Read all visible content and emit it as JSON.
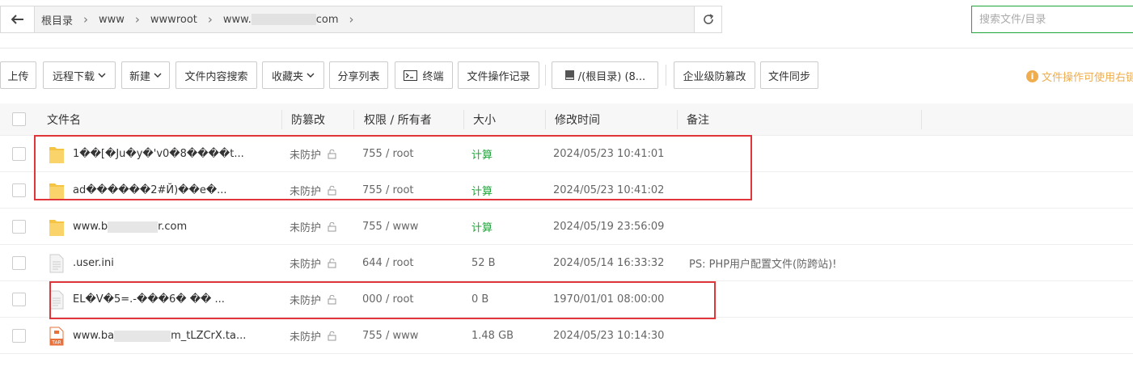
{
  "pathbar": {
    "crumbs": [
      "根目录",
      "www",
      "wwwroot",
      "www.",
      "com"
    ],
    "search_placeholder": "搜索文件/目录"
  },
  "toolbar": {
    "buttons": [
      "上传",
      "远程下载",
      "新建",
      "文件内容搜索",
      "收藏夹",
      "分享列表",
      "终端",
      "文件操作记录",
      "/(根目录) (8...",
      "企业级防篡改",
      "文件同步"
    ],
    "notice": "文件操作可使用右键"
  },
  "table": {
    "headers": [
      "文件名",
      "防篡改",
      "权限 / 所有者",
      "大小",
      "修改时间",
      "备注"
    ],
    "rows": [
      {
        "icon": "folder",
        "name": "1��[�\u0001Ju�y�'v0�8����t...",
        "protect": "未防护",
        "perm": "755 / root",
        "size": "计算",
        "mtime": "2024/05/23 10:41:01",
        "note": ""
      },
      {
        "icon": "folder",
        "name": "ad�\u0001�����2\u0001\u0001\u0001#Й)�\u0001�e�...",
        "protect": "未防护",
        "perm": "755 / root",
        "size": "计算",
        "mtime": "2024/05/23 10:41:02",
        "note": ""
      },
      {
        "icon": "folder",
        "name_a": "www.b",
        "name_b": "r.com",
        "protect": "未防护",
        "perm": "755 / www",
        "size": "计算",
        "mtime": "2024/05/19 23:56:09",
        "note": ""
      },
      {
        "icon": "file",
        "name": ".user.ini",
        "protect": "未防护",
        "perm": "644 / root",
        "size": "52 B",
        "mtime": "2024/05/14 16:33:32",
        "note": "PS: PHP用户配置文件(防跨站)!"
      },
      {
        "icon": "file",
        "name": "EL�\u0001V�5=.\u0001-���6� �\u0001� ...",
        "protect": "未防护",
        "perm": "000 / root",
        "size": "0 B",
        "mtime": "1970/01/01 08:00:00",
        "note": ""
      },
      {
        "icon": "tar",
        "name_a": "www.ba",
        "name_b": "m_tLZCrX.ta...",
        "protect": "未防护",
        "perm": "755 / www",
        "size": "1.48 GB",
        "mtime": "2024/05/23 10:14:30",
        "note": ""
      }
    ]
  },
  "icons": {
    "tar_label": "TAR"
  },
  "colors": {
    "accent": "#20a53a",
    "warning": "#f0ad4e",
    "highlight": "#e0353b",
    "folder": "#f5c443"
  }
}
